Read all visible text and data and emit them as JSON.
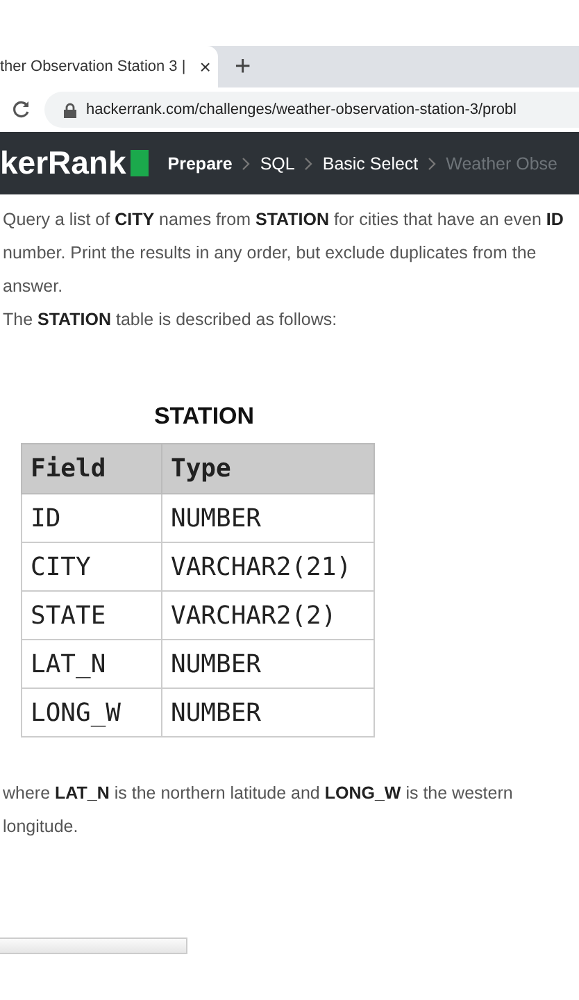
{
  "browser": {
    "tab_title": "ther Observation Station 3 |",
    "close": "×",
    "new_tab": "+",
    "url": "hackerrank.com/challenges/weather-observation-station-3/probl"
  },
  "nav": {
    "logo": "kerRank",
    "breadcrumbs": [
      {
        "label": "Prepare",
        "current": false,
        "bold": true
      },
      {
        "label": "SQL",
        "current": false,
        "bold": false
      },
      {
        "label": "Basic Select",
        "current": false,
        "bold": false
      },
      {
        "label": "Weather Obse",
        "current": true,
        "bold": false
      }
    ]
  },
  "description": [
    "Query a list of **CITY** names from **STATION** for cities that have an even **ID** number. Print the results in any order, but exclude duplicates from the answer.",
    "The **STATION** table is described as follows:"
  ],
  "table": {
    "title": "STATION",
    "columns": [
      "Field",
      "Type"
    ],
    "rows": [
      [
        "ID",
        "NUMBER"
      ],
      [
        "CITY",
        "VARCHAR2(21)"
      ],
      [
        "STATE",
        "VARCHAR2(2)"
      ],
      [
        "LAT_N",
        "NUMBER"
      ],
      [
        "LONG_W",
        "NUMBER"
      ]
    ]
  },
  "note": "where **LAT_N** is the northern latitude and **LONG_W** is the western longitude."
}
